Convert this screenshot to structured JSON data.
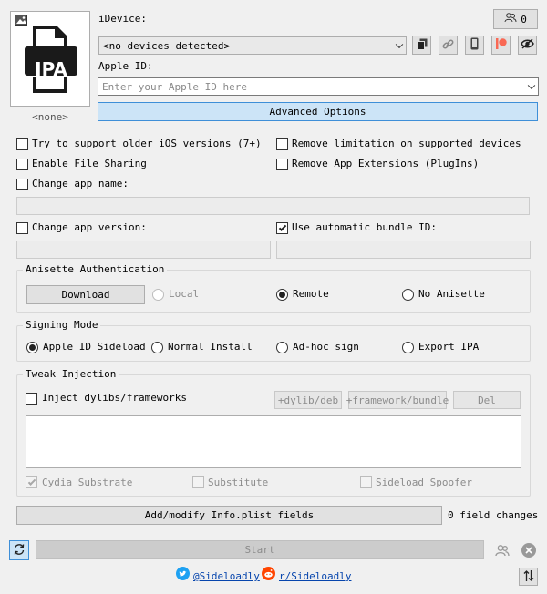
{
  "file_icon": {
    "label": "IPA",
    "caption": "<none>"
  },
  "header": {
    "idevice_label": "iDevice:",
    "device_select_value": "<no devices detected>",
    "apple_id_label": "Apple ID:",
    "apple_id_placeholder": "Enter your Apple ID here",
    "account_count": "0",
    "advanced_options_label": "Advanced Options"
  },
  "options": {
    "older_ios": "Try to support older iOS versions (7+)",
    "file_sharing": "Enable File Sharing",
    "change_name": "Change app name:",
    "remove_limitation": "Remove limitation on supported devices",
    "remove_extensions": "Remove App Extensions (PlugIns)",
    "change_version": "Change app version:",
    "auto_bundle": "Use automatic bundle ID:",
    "auto_bundle_checked": true
  },
  "anisette": {
    "title": "Anisette Authentication",
    "download_label": "Download",
    "local": "Local",
    "remote": "Remote",
    "none": "No Anisette",
    "selected": "remote"
  },
  "signing": {
    "title": "Signing Mode",
    "apple_id_sideload": "Apple ID Sideload",
    "normal_install": "Normal Install",
    "adhoc": "Ad-hoc sign",
    "export_ipa": "Export IPA",
    "selected": "apple_id_sideload"
  },
  "tweak": {
    "title": "Tweak Injection",
    "inject": "Inject dylibs/frameworks",
    "add_dylib": "+dylib/deb",
    "add_framework": "+framework/bundle",
    "del": "Del",
    "cydia": "Cydia Substrate",
    "substitute": "Substitute",
    "spoofer": "Sideload Spoofer",
    "cydia_checked": true
  },
  "plist": {
    "button_label": "Add/modify Info.plist fields",
    "changes": "0 field changes"
  },
  "footer": {
    "start_label": "Start",
    "twitter": "@Sideloadly",
    "reddit": "r/Sideloadly"
  },
  "colors": {
    "advanced_bg": "#cce4f7",
    "advanced_border": "#3e8fd8",
    "twitter": "#1da1f2",
    "reddit": "#ff4500"
  }
}
